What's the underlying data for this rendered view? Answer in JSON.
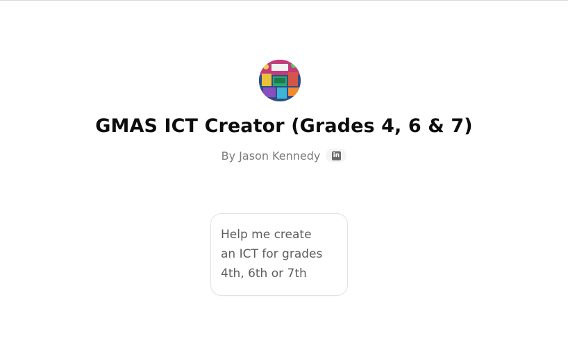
{
  "gpt": {
    "title": "GMAS ICT Creator (Grades 4, 6 & 7)",
    "author": "By Jason Kennedy",
    "social_icon": "linkedin-icon",
    "social_icon_text": "in"
  },
  "starters": [
    {
      "text": "Help me create\nan ICT for grades\n4th, 6th or 7th"
    }
  ],
  "colors": {
    "title": "#0d0d0d",
    "byline": "#7a7a7a",
    "starter_border": "#e2e2e2",
    "starter_text": "#5d5d5d"
  }
}
